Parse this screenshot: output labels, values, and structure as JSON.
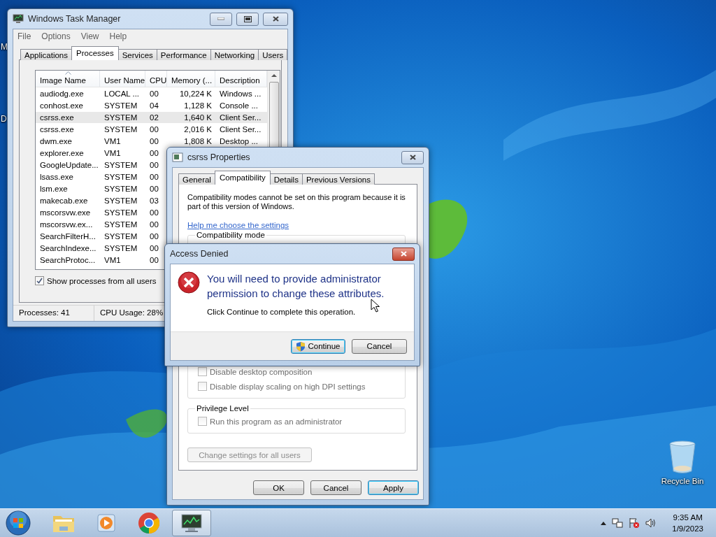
{
  "desktop": {
    "cut_icons": [
      {
        "label": "M"
      },
      {
        "label": "D"
      }
    ],
    "recycle_bin": {
      "label": "Recycle Bin"
    }
  },
  "task_manager": {
    "title": "Windows Task Manager",
    "menu": [
      "File",
      "Options",
      "View",
      "Help"
    ],
    "tabs": [
      {
        "label": "Applications",
        "selected": false
      },
      {
        "label": "Processes",
        "selected": true
      },
      {
        "label": "Services",
        "selected": false
      },
      {
        "label": "Performance",
        "selected": false
      },
      {
        "label": "Networking",
        "selected": false
      },
      {
        "label": "Users",
        "selected": false
      }
    ],
    "columns": [
      {
        "label": "Image Name",
        "sorted": true
      },
      {
        "label": "User Name",
        "sorted": false
      },
      {
        "label": "CPU",
        "sorted": false
      },
      {
        "label": "Memory (...",
        "sorted": false
      },
      {
        "label": "Description",
        "sorted": false
      }
    ],
    "rows": [
      {
        "image_name": "audiodg.exe",
        "user_name": "LOCAL ...",
        "cpu": "00",
        "memory": "10,224 K",
        "description": "Windows ...",
        "selected": false
      },
      {
        "image_name": "conhost.exe",
        "user_name": "SYSTEM",
        "cpu": "04",
        "memory": "1,128 K",
        "description": "Console ...",
        "selected": false
      },
      {
        "image_name": "csrss.exe",
        "user_name": "SYSTEM",
        "cpu": "02",
        "memory": "1,640 K",
        "description": "Client Ser...",
        "selected": true
      },
      {
        "image_name": "csrss.exe",
        "user_name": "SYSTEM",
        "cpu": "00",
        "memory": "2,016 K",
        "description": "Client Ser...",
        "selected": false
      },
      {
        "image_name": "dwm.exe",
        "user_name": "VM1",
        "cpu": "00",
        "memory": "1,808 K",
        "description": "Desktop ...",
        "selected": false
      },
      {
        "image_name": "explorer.exe",
        "user_name": "VM1",
        "cpu": "00",
        "selected": false
      },
      {
        "image_name": "GoogleUpdate...",
        "user_name": "SYSTEM",
        "cpu": "00",
        "selected": false
      },
      {
        "image_name": "lsass.exe",
        "user_name": "SYSTEM",
        "cpu": "00",
        "selected": false
      },
      {
        "image_name": "lsm.exe",
        "user_name": "SYSTEM",
        "cpu": "00",
        "selected": false
      },
      {
        "image_name": "makecab.exe",
        "user_name": "SYSTEM",
        "cpu": "03",
        "selected": false
      },
      {
        "image_name": "mscorsvw.exe",
        "user_name": "SYSTEM",
        "cpu": "00",
        "selected": false
      },
      {
        "image_name": "mscorsvw.ex...",
        "user_name": "SYSTEM",
        "cpu": "00",
        "selected": false
      },
      {
        "image_name": "SearchFilterH...",
        "user_name": "SYSTEM",
        "cpu": "00",
        "selected": false
      },
      {
        "image_name": "SearchIndexe...",
        "user_name": "SYSTEM",
        "cpu": "00",
        "selected": false
      },
      {
        "image_name": "SearchProtoc...",
        "user_name": "VM1",
        "cpu": "00",
        "selected": false
      }
    ],
    "show_all": {
      "label": "Show processes from all users",
      "checked": true
    },
    "status": [
      "Processes: 41",
      "CPU Usage: 28%"
    ]
  },
  "properties": {
    "title": "csrss Properties",
    "tabs": [
      {
        "label": "General",
        "selected": false
      },
      {
        "label": "Compatibility",
        "selected": true
      },
      {
        "label": "Details",
        "selected": false
      },
      {
        "label": "Previous Versions",
        "selected": false
      }
    ],
    "note": "Compatibility modes cannot be set on this program because it is part of this version of Windows.",
    "help_link": "Help me choose the settings",
    "groups": [
      {
        "kind": "covered",
        "legend": "Compatibility mode",
        "options": [
          {
            "label": "Disable desktop composition",
            "checked": false
          },
          {
            "label": "Disable display scaling on high DPI settings",
            "checked": false
          }
        ]
      },
      {
        "kind": "plain",
        "legend": "Privilege Level",
        "options": [
          {
            "label": "Run this program as an administrator",
            "checked": false
          }
        ]
      }
    ],
    "change_button": {
      "label": "Change settings for all users",
      "disabled": true
    },
    "buttons": [
      {
        "label": "OK",
        "default": false
      },
      {
        "label": "Cancel",
        "default": false
      },
      {
        "label": "Apply",
        "default": true
      }
    ]
  },
  "access_denied": {
    "title": "Access Denied",
    "heading": "You will need to provide administrator permission to change these attributes.",
    "message": "Click Continue to complete this operation.",
    "buttons": [
      {
        "label": "Continue",
        "kind": "shield",
        "default": true
      },
      {
        "label": "Cancel",
        "kind": "plain",
        "default": false
      }
    ]
  },
  "taskbar": {
    "apps": [
      {
        "kind": "folder",
        "selected": false
      },
      {
        "kind": "media",
        "selected": false
      },
      {
        "kind": "browser",
        "selected": false
      },
      {
        "kind": "monitor",
        "selected": true
      }
    ],
    "clock": {
      "time": "9:35 AM",
      "date": "1/9/2023"
    }
  }
}
